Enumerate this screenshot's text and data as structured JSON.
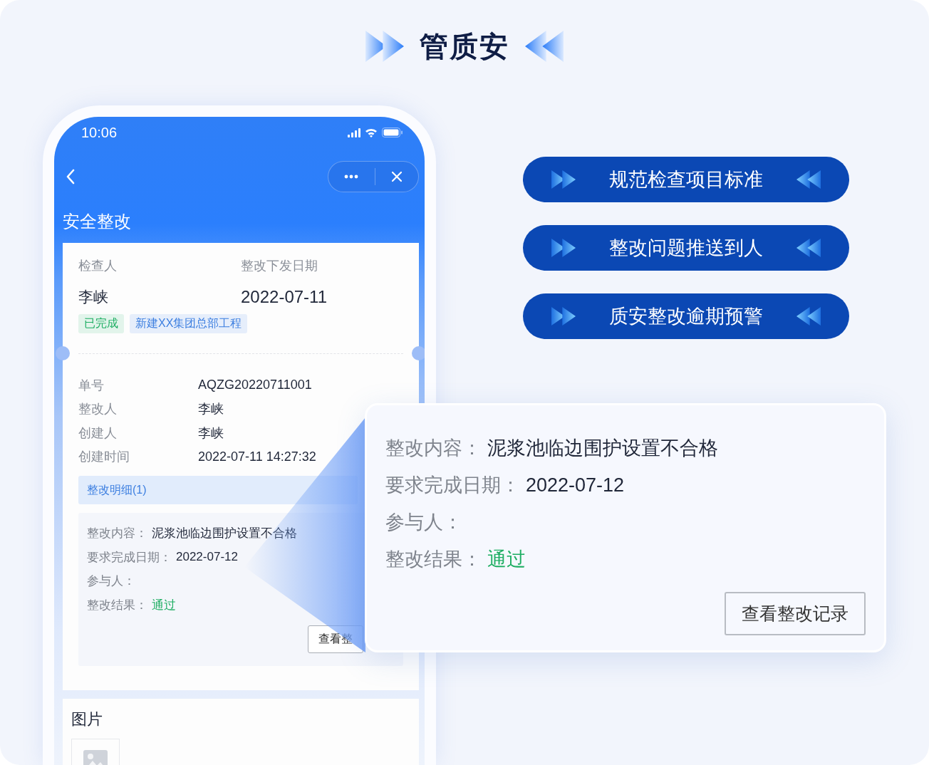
{
  "header": {
    "title": "管质安"
  },
  "phone": {
    "status_bar": {
      "time": "10:06"
    },
    "page_title": "安全整改",
    "summary": {
      "fields": [
        {
          "label": "检查人",
          "value": "李峡"
        },
        {
          "label": "整改下发日期",
          "value": "2022-07-11"
        }
      ],
      "tags": [
        {
          "text": "已完成",
          "color": "#1fae63"
        },
        {
          "text": "新建XX集团总部工程",
          "color": "#3d7fe0"
        }
      ]
    },
    "details": [
      {
        "label": "单号",
        "value": "AQZG20220711001"
      },
      {
        "label": "整改人",
        "value": "李峡"
      },
      {
        "label": "创建人",
        "value": "李峡"
      },
      {
        "label": "创建时间",
        "value": "2022-07-11 14:27:32"
      }
    ],
    "section_tab": "整改明细(1)",
    "item": {
      "fields": [
        {
          "label": "整改内容：",
          "value": "泥浆池临边围护设置不合格",
          "kind": "text"
        },
        {
          "label": "要求完成日期：",
          "value": "2022-07-12",
          "kind": "text"
        },
        {
          "label": "参与人：",
          "kind": "text"
        },
        {
          "label": "整改结果：",
          "value": "通过",
          "kind": "result"
        }
      ],
      "button": "查看整"
    },
    "images": {
      "title": "图片"
    }
  },
  "features": [
    "规范检查项目标准",
    "整改问题推送到人",
    "质安整改逾期预警"
  ],
  "callout": {
    "fields": [
      {
        "label": "整改内容：",
        "value": "泥浆池临边围护设置不合格",
        "kind": "text"
      },
      {
        "label": "要求完成日期：",
        "value": "2022-07-12",
        "kind": "text"
      },
      {
        "label": "参与人：",
        "kind": "text"
      },
      {
        "label": "整改结果：",
        "value": "通过",
        "kind": "result"
      }
    ],
    "button": "查看整改记录"
  }
}
